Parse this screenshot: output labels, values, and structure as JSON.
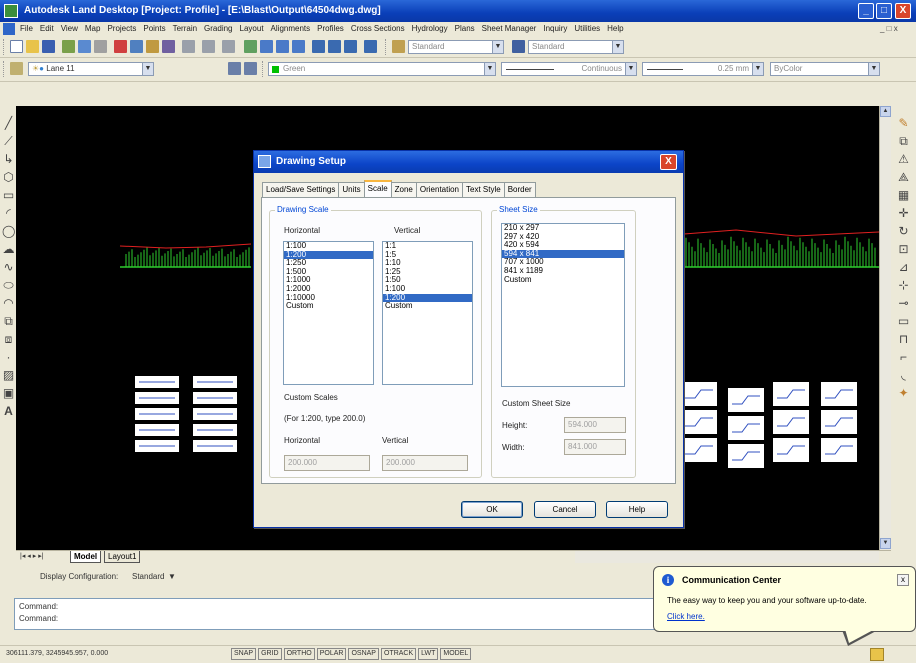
{
  "window": {
    "title": "Autodesk Land Desktop [Project: Profile] - [E:\\Blast\\Output\\64504dwg.dwg]",
    "minimize": "_",
    "maximize": "□",
    "close": "X"
  },
  "menu": {
    "items": [
      "File",
      "Edit",
      "View",
      "Map",
      "Projects",
      "Points",
      "Terrain",
      "Grading",
      "Layout",
      "Alignments",
      "Profiles",
      "Cross Sections",
      "Hydrology",
      "Plans",
      "Sheet Manager",
      "Inquiry",
      "Utilities",
      "Help"
    ],
    "mdi_controls": "_ □ x"
  },
  "toolbar1": {
    "text_style": "Standard",
    "dim_style": "Standard"
  },
  "toolbar2": {
    "layer": "Lane 11",
    "color": "Green",
    "linetype": "Continuous",
    "lineweight": "0.25 mm",
    "plot_style": "ByColor",
    "color_hex": "#00c000"
  },
  "dialog": {
    "title": "Drawing Setup",
    "close": "X",
    "tabs": [
      "Load/Save Settings",
      "Units",
      "Scale",
      "Zone",
      "Orientation",
      "Text Style",
      "Border"
    ],
    "active_tab": "Scale",
    "drawing_scale": {
      "legend": "Drawing Scale",
      "horizontal_label": "Horizontal",
      "vertical_label": "Vertical",
      "horizontal": [
        "1:100",
        "1:200",
        "1:250",
        "1:500",
        "1:1000",
        "1:2000",
        "1:10000",
        "Custom"
      ],
      "horizontal_selected": 1,
      "vertical": [
        "1:1",
        "1:5",
        "1:10",
        "1:25",
        "1:50",
        "1:100",
        "1:200",
        "Custom"
      ],
      "vertical_selected": 6,
      "custom_scales_label": "Custom Scales",
      "custom_hint": "(For 1:200, type 200.0)",
      "custom_h_label": "Horizontal",
      "custom_v_label": "Vertical",
      "custom_h_value": "200.000",
      "custom_v_value": "200.000"
    },
    "sheet_size": {
      "legend": "Sheet Size",
      "items": [
        "210 x 297",
        "297 x 420",
        "420 x 594",
        "594 x 841",
        "707 x 1000",
        "841 x 1189",
        "Custom"
      ],
      "selected": 3,
      "custom_label": "Custom Sheet Size",
      "height_label": "Height:",
      "height_value": "594.000",
      "width_label": "Width:",
      "width_value": "841.000"
    },
    "buttons": {
      "ok": "OK",
      "cancel": "Cancel",
      "help": "Help"
    }
  },
  "layout_tabs": {
    "nav": "|◂  ◂  ▸  ▸|",
    "tabs": [
      "Model",
      "Layout1"
    ]
  },
  "display_config": {
    "label": "Display Configuration:",
    "value": "Standard"
  },
  "command": {
    "lines": [
      "Command:",
      "Command:"
    ]
  },
  "status": {
    "coords": "306111.379, 3245945.957, 0.000",
    "buttons": [
      "SNAP",
      "GRID",
      "ORTHO",
      "POLAR",
      "OSNAP",
      "OTRACK",
      "LWT",
      "MODEL"
    ]
  },
  "balloon": {
    "title": "Communication Center",
    "message": "The easy way to keep you and your software up-to-date.",
    "link": "Click here.",
    "close": "x"
  },
  "colors": {
    "titlebar": "#0a3fb8",
    "selection": "#316ac5",
    "canvas": "#000000",
    "profile_green": "#2ecc2e",
    "profile_red": "#e02020"
  }
}
